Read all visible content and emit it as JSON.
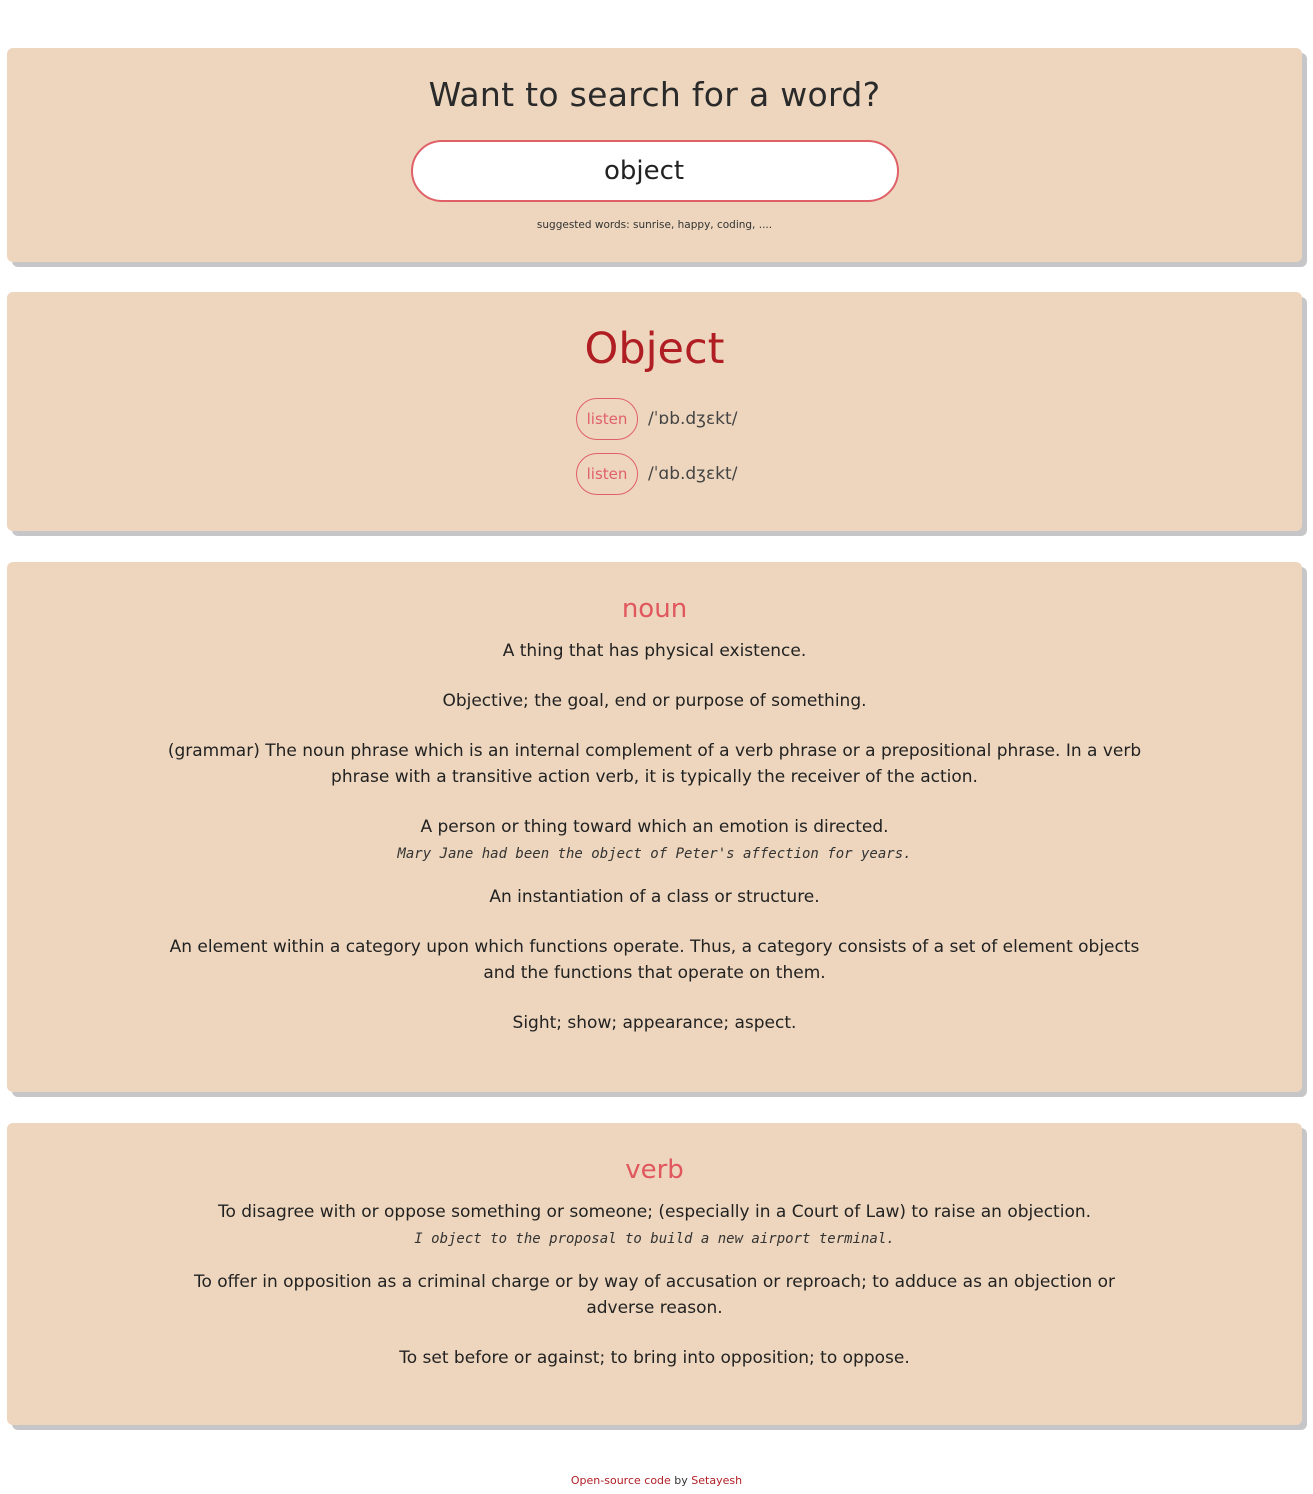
{
  "search": {
    "title": "Want to search for a word?",
    "value": "object",
    "suggestion": "suggested words: sunrise, happy, coding, ...."
  },
  "word": {
    "headword": "Object",
    "phonetics": [
      {
        "button": "listen",
        "text": "/ˈɒb.dʒɛkt/"
      },
      {
        "button": "listen",
        "text": "/ˈɑb.dʒɛkt/"
      }
    ]
  },
  "meanings": [
    {
      "part_of_speech": "noun",
      "definitions": [
        {
          "text": "A thing that has physical existence."
        },
        {
          "text": "Objective; the goal, end or purpose of something."
        },
        {
          "text": "(grammar) The noun phrase which is an internal complement of a verb phrase or a prepositional phrase. In a verb phrase with a transitive action verb, it is typically the receiver of the action."
        },
        {
          "text": "A person or thing toward which an emotion is directed.",
          "example": "Mary Jane had been the object of Peter's affection for years."
        },
        {
          "text": "An instantiation of a class or structure."
        },
        {
          "text": "An element within a category upon which functions operate. Thus, a category consists of a set of element objects and the functions that operate on them."
        },
        {
          "text": "Sight; show; appearance; aspect."
        }
      ]
    },
    {
      "part_of_speech": "verb",
      "definitions": [
        {
          "text": "To disagree with or oppose something or someone; (especially in a Court of Law) to raise an objection.",
          "example": "I object to the proposal to build a new airport terminal."
        },
        {
          "text": "To offer in opposition as a criminal charge or by way of accusation or reproach; to adduce as an objection or adverse reason."
        },
        {
          "text": "To set before or against; to bring into opposition; to oppose."
        }
      ]
    }
  ],
  "footer": {
    "link_text": "Open-source code",
    "by_text": " by ",
    "author": "Setayesh"
  }
}
